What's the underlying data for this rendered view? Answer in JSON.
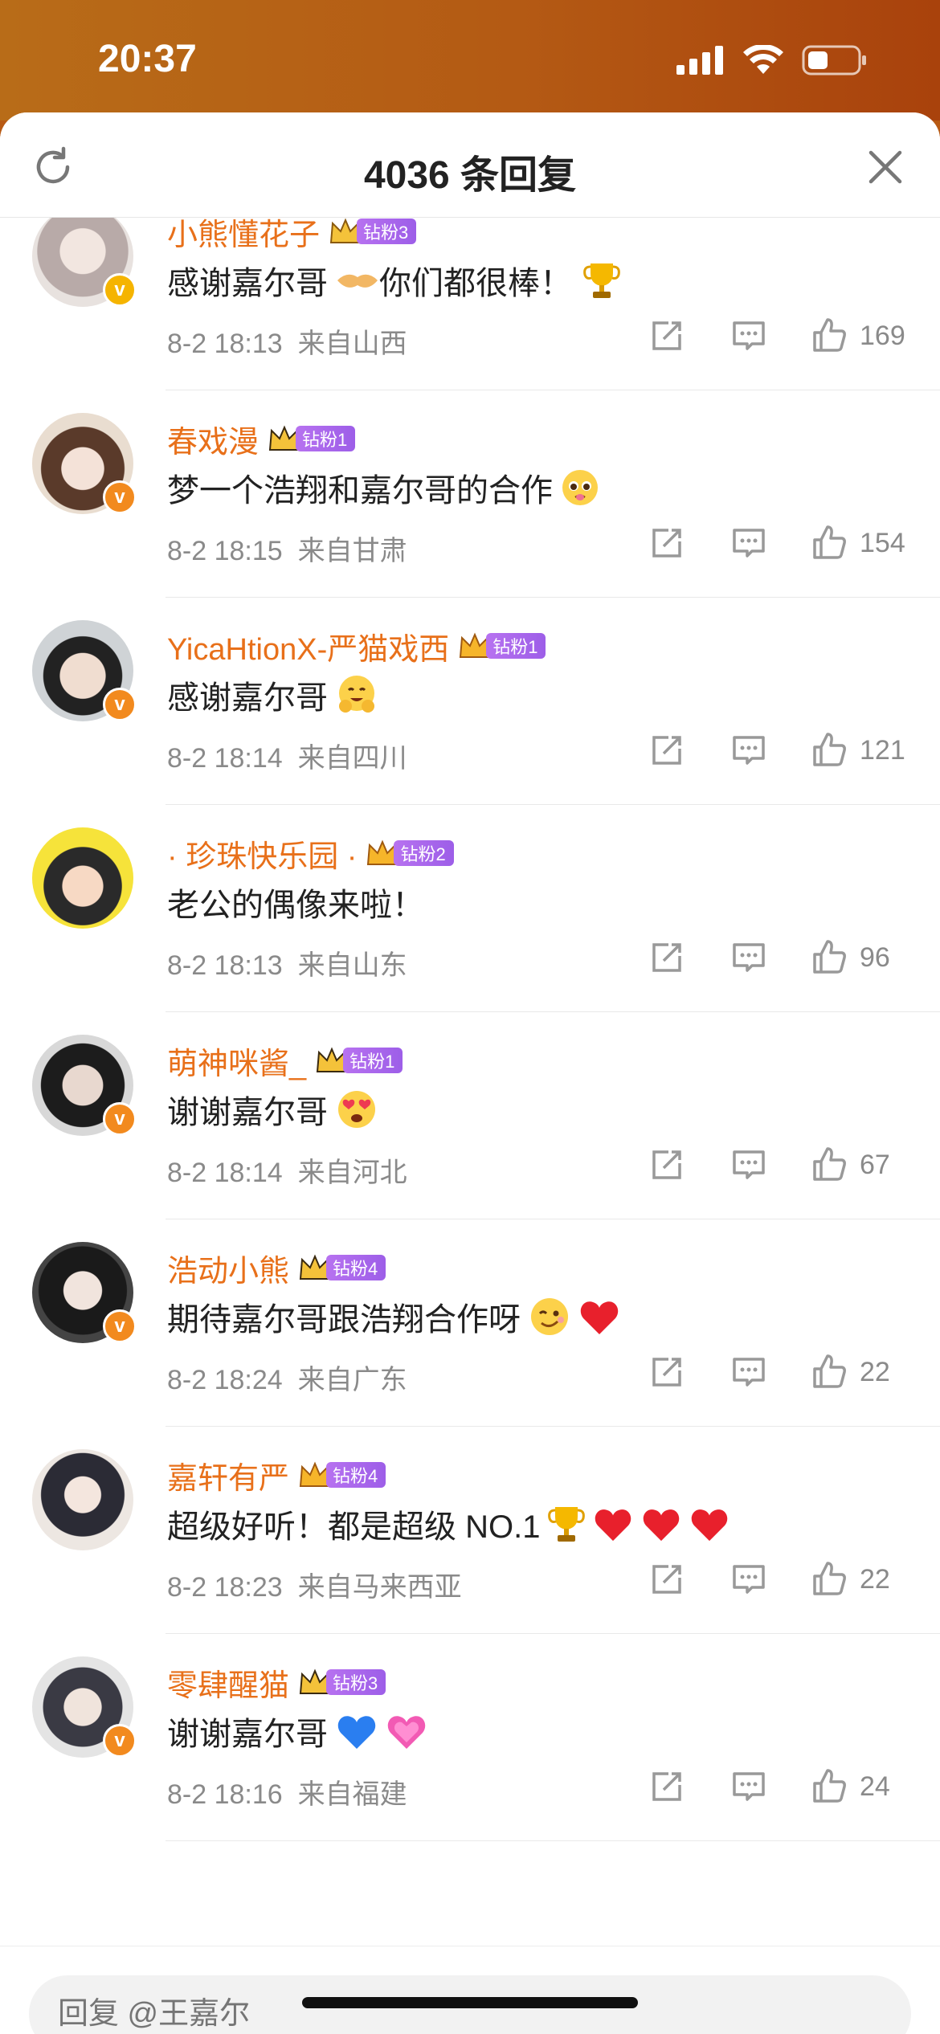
{
  "status_bar": {
    "time": "20:37"
  },
  "header": {
    "title": "4036 条回复"
  },
  "comments": [
    {
      "username": "小熊懂花子",
      "fan_level": "钻粉3",
      "text": "感谢嘉尔哥",
      "emojis": [
        "handshake",
        "trophy"
      ],
      "text2": "你们都很棒！",
      "time": "8-2 18:13",
      "location": "来自山西",
      "likes": "169"
    },
    {
      "username": "春戏漫",
      "fan_level": "钻粉1",
      "text": "梦一个浩翔和嘉尔哥的合作",
      "emojis": [
        "pleading"
      ],
      "time": "8-2 18:15",
      "location": "来自甘肃",
      "likes": "154"
    },
    {
      "username": "YicaHtionX-严猫戏西",
      "fan_level": "钻粉1",
      "text": "感谢嘉尔哥",
      "emojis": [
        "hug"
      ],
      "time": "8-2 18:14",
      "location": "来自四川",
      "likes": "121"
    },
    {
      "username": "· 珍珠快乐园 ·",
      "fan_level": "钻粉2",
      "text": "老公的偶像来啦！",
      "emojis": [],
      "time": "8-2 18:13",
      "location": "来自山东",
      "likes": "96"
    },
    {
      "username": "萌神咪酱_",
      "fan_level": "钻粉1",
      "text": "谢谢嘉尔哥",
      "emojis": [
        "heart-eyes"
      ],
      "time": "8-2 18:14",
      "location": "来自河北",
      "likes": "67"
    },
    {
      "username": "浩动小熊",
      "fan_level": "钻粉4",
      "text": "期待嘉尔哥跟浩翔合作呀",
      "emojis": [
        "wink",
        "red-heart"
      ],
      "time": "8-2 18:24",
      "location": "来自广东",
      "likes": "22"
    },
    {
      "username": "嘉轩有严",
      "fan_level": "钻粉4",
      "text": "超级好听！都是超级 NO.1",
      "emojis": [
        "trophy",
        "red-heart",
        "red-heart",
        "red-heart"
      ],
      "time": "8-2 18:23",
      "location": "来自马来西亚",
      "likes": "22"
    },
    {
      "username": "零肆醒猫",
      "fan_level": "钻粉3",
      "text": "谢谢嘉尔哥",
      "emojis": [
        "blue-heart",
        "pink-heart"
      ],
      "time": "8-2 18:16",
      "location": "来自福建",
      "likes": "24"
    }
  ],
  "reply": {
    "placeholder": "回复 @王嘉尔"
  },
  "colors": {
    "username": "#e8701a",
    "fan_badge": "#a663ec",
    "verified": "#f28a1e"
  }
}
